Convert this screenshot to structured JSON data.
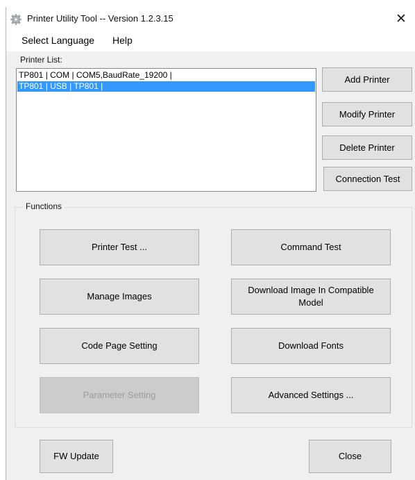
{
  "window": {
    "title": "Printer Utility Tool -- Version 1.2.3.15",
    "close_glyph": "✕"
  },
  "menu": {
    "items": [
      "Select Language",
      "Help"
    ]
  },
  "printer_list": {
    "label": "Printer List:",
    "rows": [
      "TP801 | COM | COM5,BaudRate_19200 |",
      "TP801 | USB | TP801 |"
    ],
    "selected_index": 1
  },
  "side_buttons": {
    "add": "Add Printer",
    "modify": "Modify Printer",
    "delete": "Delete Printer",
    "connection_test": "Connection Test"
  },
  "functions": {
    "label": "Functions",
    "printer_test": "Printer Test ...",
    "command_test": "Command Test",
    "manage_images": "Manage Images",
    "download_image": "Download Image In Compatible Model",
    "code_page": "Code Page Setting",
    "download_fonts": "Download Fonts",
    "parameter_setting": "Parameter Setting",
    "advanced_settings": "Advanced Settings ..."
  },
  "footer": {
    "fw_update": "FW Update",
    "close": "Close"
  },
  "colors": {
    "selection": "#3399ff",
    "window_bg": "#f0f0f0",
    "button_bg": "#e1e1e1"
  },
  "icons": {
    "app": "gear-icon",
    "close": "close-icon"
  }
}
